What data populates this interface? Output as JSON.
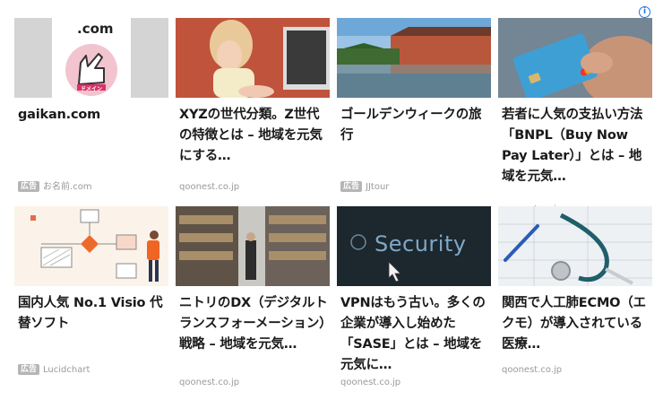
{
  "info_label": "i",
  "cards": [
    {
      "title": "gaikan.com",
      "source": "お名前.com",
      "ad": "広告",
      "thumb_text": ".com",
      "thumb_sub": "ドメイン"
    },
    {
      "title": "XYZの世代分類。Z世代の特徴とは – 地域を元気にする…",
      "source": "qoonest.co.jp",
      "ad": ""
    },
    {
      "title": "ゴールデンウィークの旅行",
      "source": "JJtour",
      "ad": "広告"
    },
    {
      "title": "若者に人気の支払い方法「BNPL（Buy Now Pay Later）」とは – 地域を元気…",
      "source": "qoonest.co.jp",
      "ad": ""
    },
    {
      "title": "国内人気 No.1 Visio 代替ソフト",
      "source": "Lucidchart",
      "ad": "広告"
    },
    {
      "title": "ニトリのDX（デジタルトランスフォーメーション）戦略 – 地域を元気…",
      "source": "qoonest.co.jp",
      "ad": ""
    },
    {
      "title": "VPNはもう古い。多くの企業が導入し始めた「SASE」とは – 地域を元気に…",
      "source": "qoonest.co.jp",
      "ad": "",
      "thumb_text": "Security"
    },
    {
      "title": "関西で人工肺ECMO（エクモ）が導入されている医療…",
      "source": "qoonest.co.jp",
      "ad": ""
    }
  ]
}
